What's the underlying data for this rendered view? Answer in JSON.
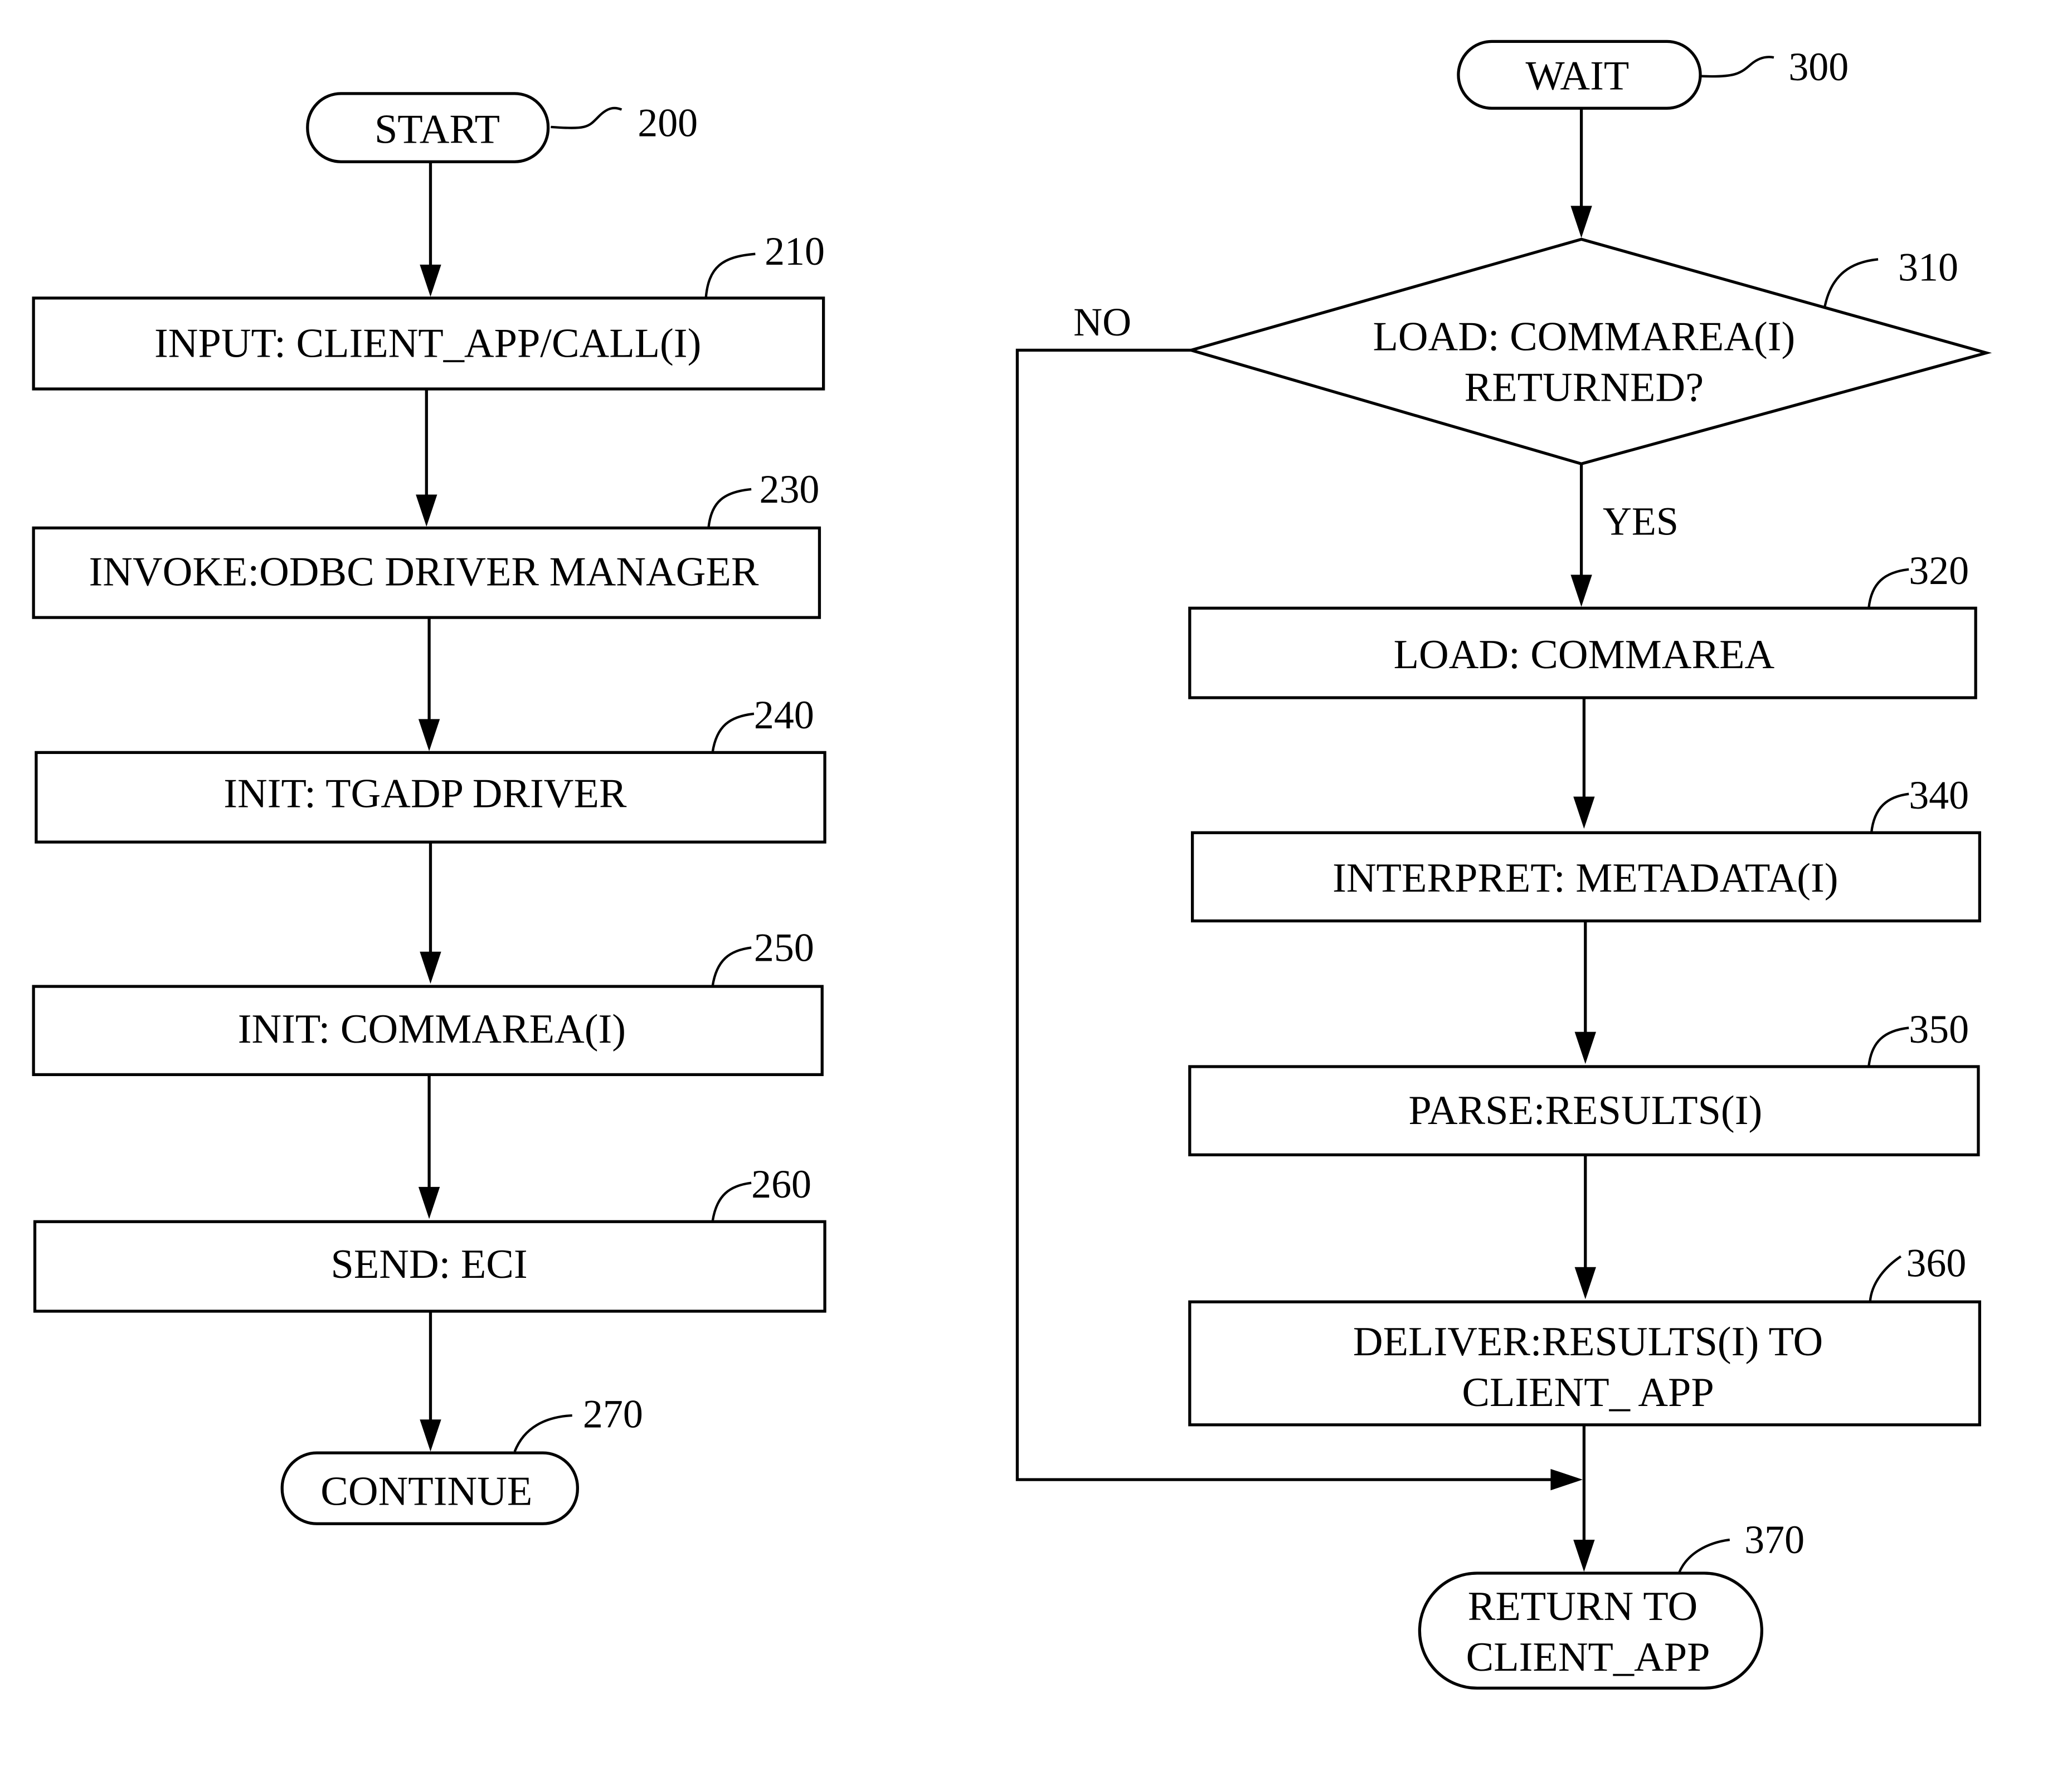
{
  "flowchart_left": {
    "start": {
      "ref": "200",
      "label": "START"
    },
    "steps": [
      {
        "ref": "210",
        "label": "INPUT: CLIENT_APP/CALL(I)"
      },
      {
        "ref": "230",
        "label": "INVOKE:ODBC DRIVER MANAGER"
      },
      {
        "ref": "240",
        "label": "INIT: TGADP DRIVER"
      },
      {
        "ref": "250",
        "label": "INIT: COMMAREA(I)"
      },
      {
        "ref": "260",
        "label": "SEND: ECI"
      }
    ],
    "end": {
      "ref": "270",
      "label": "CONTINUE"
    }
  },
  "flowchart_right": {
    "start": {
      "ref": "300",
      "label": "WAIT"
    },
    "decision": {
      "ref": "310",
      "line1": "LOAD: COMMAREA(I)",
      "line2": "RETURNED?",
      "no_label": "NO",
      "yes_label": "YES"
    },
    "steps": [
      {
        "ref": "320",
        "label": "LOAD: COMMAREA"
      },
      {
        "ref": "340",
        "label": "INTERPRET: METADATA(I)"
      },
      {
        "ref": "350",
        "label": "PARSE:RESULTS(I)"
      },
      {
        "ref": "360",
        "line1": "DELIVER:RESULTS(I) TO",
        "line2": "CLIENT_ APP"
      }
    ],
    "end": {
      "ref": "370",
      "line1": "RETURN TO",
      "line2": "CLIENT_APP"
    }
  }
}
